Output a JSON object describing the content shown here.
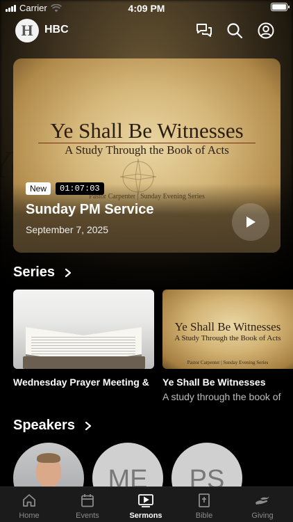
{
  "status_bar": {
    "carrier": "Carrier",
    "time": "4:09 PM"
  },
  "header": {
    "logo_letter": "H",
    "title": "HBC"
  },
  "top_icons": [
    "chat-icon",
    "search-icon",
    "account-icon"
  ],
  "featured": {
    "artwork_title": "Ye Shall Be Witnesses",
    "artwork_subtitle": "A Study Through the Book of Acts",
    "artwork_credit": "Pastor Carpenter | Sunday Evening Series",
    "badge_new": "New",
    "duration": "01:07:03",
    "title": "Sunday PM Service",
    "date": "September 7, 2025"
  },
  "series": {
    "heading": "Series",
    "items": [
      {
        "name": "Wednesday Prayer Meeting &",
        "description": ""
      },
      {
        "name": "Ye Shall Be Witnesses",
        "description": "A study through the book of",
        "artwork_title": "Ye Shall Be Witnesses",
        "artwork_subtitle": "A Study Through the Book of Acts",
        "artwork_credit": "Pastor Carpenter | Sunday Evening Series"
      }
    ]
  },
  "speakers": {
    "heading": "Speakers",
    "items": [
      {
        "initials": ""
      },
      {
        "initials": "ME"
      },
      {
        "initials": "PS"
      }
    ]
  },
  "tabs": [
    {
      "label": "Home",
      "icon": "home-icon",
      "active": false
    },
    {
      "label": "Events",
      "icon": "calendar-icon",
      "active": false
    },
    {
      "label": "Sermons",
      "icon": "play-screen-icon",
      "active": true
    },
    {
      "label": "Bible",
      "icon": "bible-icon",
      "active": false
    },
    {
      "label": "Giving",
      "icon": "giving-icon",
      "active": false
    }
  ],
  "colors": {
    "tab_bar": "#1b1b1b",
    "active_tab": "#ffffff",
    "inactive_tab": "#8c8c8c"
  }
}
